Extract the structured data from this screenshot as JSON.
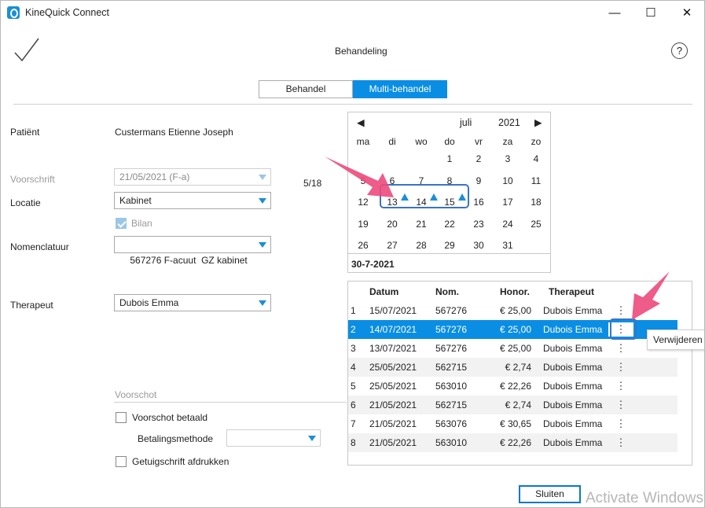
{
  "window": {
    "title": "KineQuick Connect",
    "minimize": "—",
    "maximize": "☐",
    "close": "✕"
  },
  "header": {
    "title": "Behandeling",
    "confirm_glyph": "✓",
    "help": "?"
  },
  "tabs": [
    {
      "label": "Behandel",
      "active": false
    },
    {
      "label": "Multi-behandel",
      "active": true
    }
  ],
  "form": {
    "patient_label": "Patiënt",
    "patient_value": "Custermans Etienne Joseph",
    "voorschrift_label": "Voorschrift",
    "voorschrift_value": "21/05/2021 (F-a)",
    "counter": "5/18",
    "locatie_label": "Locatie",
    "locatie_value": "Kabinet",
    "bilan_label": "Bilan",
    "nomenclatuur_label": "Nomenclatuur",
    "nomenclatuur_value": "567276 F-acuut  GZ kabinet",
    "therapeut_label": "Therapeut",
    "therapeut_value": "Dubois Emma",
    "voorschot_section": "Voorschot",
    "voorschot_betaald_label": "Voorschot betaald",
    "betalingsmethode_label": "Betalingsmethode",
    "betalingsmethode_value": "",
    "getuigschrift_label": "Getuigschrift afdrukken"
  },
  "calendar": {
    "prev": "◀",
    "next": "▶",
    "month": "juli",
    "year": "2021",
    "weekdays": [
      "ma",
      "di",
      "wo",
      "do",
      "vr",
      "za",
      "zo"
    ],
    "rows": [
      [
        "",
        "",
        "",
        "1",
        "2",
        "3",
        "4"
      ],
      [
        "5",
        "6",
        "7",
        "8",
        "9",
        "10",
        "11"
      ],
      [
        "12",
        "13",
        "14",
        "15",
        "16",
        "17",
        "18"
      ],
      [
        "19",
        "20",
        "21",
        "22",
        "23",
        "24",
        "25"
      ],
      [
        "26",
        "27",
        "28",
        "29",
        "30",
        "31",
        ""
      ]
    ],
    "marked_days": [
      "13",
      "14",
      "15"
    ],
    "selected_date": "30-7-2021",
    "accent": "#1a8fd6"
  },
  "table": {
    "columns": [
      "Datum",
      "Nom.",
      "Honor.",
      "Therapeut"
    ],
    "rows": [
      {
        "n": "1",
        "datum": "15/07/2021",
        "nom": "567276",
        "honor": "€ 25,00",
        "therapeut": "Dubois Emma"
      },
      {
        "n": "2",
        "datum": "14/07/2021",
        "nom": "567276",
        "honor": "€ 25,00",
        "therapeut": "Dubois Emma"
      },
      {
        "n": "3",
        "datum": "13/07/2021",
        "nom": "567276",
        "honor": "€ 25,00",
        "therapeut": "Dubois Emma"
      },
      {
        "n": "4",
        "datum": "25/05/2021",
        "nom": "562715",
        "honor": "€ 2,74",
        "therapeut": "Dubois Emma"
      },
      {
        "n": "5",
        "datum": "25/05/2021",
        "nom": "563010",
        "honor": "€ 22,26",
        "therapeut": "Dubois Emma"
      },
      {
        "n": "6",
        "datum": "21/05/2021",
        "nom": "562715",
        "honor": "€ 2,74",
        "therapeut": "Dubois Emma"
      },
      {
        "n": "7",
        "datum": "21/05/2021",
        "nom": "563076",
        "honor": "€ 30,65",
        "therapeut": "Dubois Emma"
      },
      {
        "n": "8",
        "datum": "21/05/2021",
        "nom": "563010",
        "honor": "€ 22,26",
        "therapeut": "Dubois Emma"
      }
    ],
    "selected_row": "2",
    "kebab": "⋮",
    "selected_color": "#0a8ee3"
  },
  "context_menu": {
    "item": "Verwijderen"
  },
  "footer": {
    "close_button": "Sluiten"
  },
  "watermark": "Activate Windows"
}
